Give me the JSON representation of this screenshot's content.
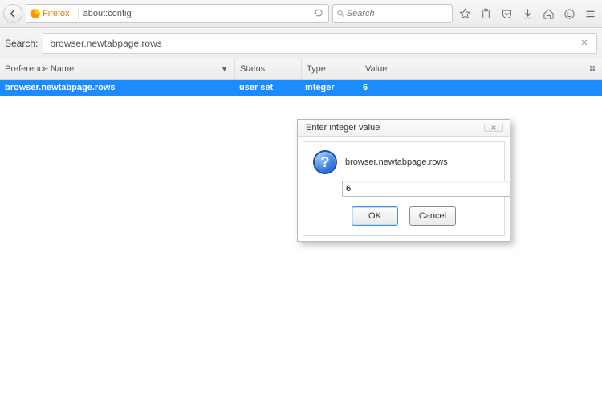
{
  "toolbar": {
    "firefox_label": "Firefox",
    "address": "about:config",
    "search_placeholder": "Search"
  },
  "config_search": {
    "label": "Search:",
    "value": "browser.newtabpage.rows"
  },
  "table": {
    "headers": {
      "name": "Preference Name",
      "status": "Status",
      "type": "Type",
      "value": "Value"
    },
    "row": {
      "name": "browser.newtabpage.rows",
      "status": "user set",
      "type": "integer",
      "value": "6"
    }
  },
  "dialog": {
    "title": "Enter integer value",
    "pref_name": "browser.newtabpage.rows",
    "input_value": "6",
    "ok": "OK",
    "cancel": "Cancel"
  }
}
